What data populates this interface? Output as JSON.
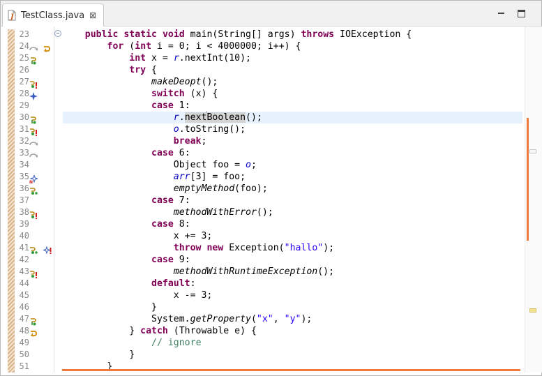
{
  "tab": {
    "title": "TestClass.java",
    "close_glyph": "⊠",
    "icon": "java-file-icon"
  },
  "window_controls": {
    "minimize": "minimize-icon",
    "maximize": "maximize-icon"
  },
  "colors": {
    "keyword": "#7f0055",
    "string": "#2a00ff",
    "field": "#0000c0",
    "comment": "#3f7f5f",
    "current_line": "#e8f2fe",
    "occurrence_mark": "#f07a3a"
  },
  "lines": [
    {
      "n": "23",
      "tokens": [
        [
          "p",
          "    "
        ],
        [
          "kw",
          "public"
        ],
        [
          "p",
          " "
        ],
        [
          "kw",
          "static"
        ],
        [
          "p",
          " "
        ],
        [
          "kw",
          "void"
        ],
        [
          "p",
          " main(String[] args) "
        ],
        [
          "kw",
          "throws"
        ],
        [
          "p",
          " IOException {"
        ]
      ]
    },
    {
      "n": "24",
      "tokens": [
        [
          "p",
          "        "
        ],
        [
          "kw",
          "for"
        ],
        [
          "p",
          " ("
        ],
        [
          "kw",
          "int"
        ],
        [
          "p",
          " i = 0; i < 4000000; i++) {"
        ]
      ]
    },
    {
      "n": "25",
      "tokens": [
        [
          "p",
          "            "
        ],
        [
          "kw",
          "int"
        ],
        [
          "p",
          " x = "
        ],
        [
          "fld",
          "r"
        ],
        [
          "p",
          ".nextInt(10);"
        ]
      ]
    },
    {
      "n": "26",
      "tokens": [
        [
          "p",
          "            "
        ],
        [
          "kw",
          "try"
        ],
        [
          "p",
          " {"
        ]
      ]
    },
    {
      "n": "27",
      "tokens": [
        [
          "p",
          "                "
        ],
        [
          "it",
          "makeDeopt"
        ],
        [
          "p",
          "();"
        ]
      ]
    },
    {
      "n": "28",
      "tokens": [
        [
          "p",
          "                "
        ],
        [
          "kw",
          "switch"
        ],
        [
          "p",
          " (x) {"
        ]
      ]
    },
    {
      "n": "29",
      "tokens": [
        [
          "p",
          "                "
        ],
        [
          "kw",
          "case"
        ],
        [
          "p",
          " 1:"
        ]
      ]
    },
    {
      "n": "30",
      "tokens": [
        [
          "p",
          "                    "
        ],
        [
          "fld",
          "r"
        ],
        [
          "p",
          "."
        ],
        [
          "occ",
          "next"
        ],
        [
          "caret",
          ""
        ],
        [
          "occ",
          "Boolean"
        ],
        [
          "p",
          "();"
        ]
      ],
      "current": true
    },
    {
      "n": "31",
      "tokens": [
        [
          "p",
          "                    "
        ],
        [
          "fld",
          "o"
        ],
        [
          "p",
          ".toString();"
        ]
      ]
    },
    {
      "n": "32",
      "tokens": [
        [
          "p",
          "                    "
        ],
        [
          "kw",
          "break"
        ],
        [
          "p",
          ";"
        ]
      ]
    },
    {
      "n": "33",
      "tokens": [
        [
          "p",
          "                "
        ],
        [
          "kw",
          "case"
        ],
        [
          "p",
          " 6:"
        ]
      ]
    },
    {
      "n": "34",
      "tokens": [
        [
          "p",
          "                    Object foo = "
        ],
        [
          "fld",
          "o"
        ],
        [
          "p",
          ";"
        ]
      ]
    },
    {
      "n": "35",
      "tokens": [
        [
          "p",
          "                    "
        ],
        [
          "fld",
          "arr"
        ],
        [
          "p",
          "[3] = foo;"
        ]
      ]
    },
    {
      "n": "36",
      "tokens": [
        [
          "p",
          "                    "
        ],
        [
          "it",
          "emptyMethod"
        ],
        [
          "p",
          "(foo);"
        ]
      ]
    },
    {
      "n": "37",
      "tokens": [
        [
          "p",
          "                "
        ],
        [
          "kw",
          "case"
        ],
        [
          "p",
          " 7:"
        ]
      ]
    },
    {
      "n": "38",
      "tokens": [
        [
          "p",
          "                    "
        ],
        [
          "it",
          "methodWithError"
        ],
        [
          "p",
          "();"
        ]
      ]
    },
    {
      "n": "39",
      "tokens": [
        [
          "p",
          "                "
        ],
        [
          "kw",
          "case"
        ],
        [
          "p",
          " 8:"
        ]
      ]
    },
    {
      "n": "40",
      "tokens": [
        [
          "p",
          "                    x += 3;"
        ]
      ]
    },
    {
      "n": "41",
      "tokens": [
        [
          "p",
          "                    "
        ],
        [
          "kw",
          "throw"
        ],
        [
          "p",
          " "
        ],
        [
          "kw",
          "new"
        ],
        [
          "p",
          " Exception("
        ],
        [
          "str",
          "\"hallo\""
        ],
        [
          "p",
          ");"
        ]
      ]
    },
    {
      "n": "42",
      "tokens": [
        [
          "p",
          "                "
        ],
        [
          "kw",
          "case"
        ],
        [
          "p",
          " 9:"
        ]
      ]
    },
    {
      "n": "43",
      "tokens": [
        [
          "p",
          "                    "
        ],
        [
          "it",
          "methodWithRuntimeException"
        ],
        [
          "p",
          "();"
        ]
      ]
    },
    {
      "n": "44",
      "tokens": [
        [
          "p",
          "                "
        ],
        [
          "kw",
          "default"
        ],
        [
          "p",
          ":"
        ]
      ]
    },
    {
      "n": "45",
      "tokens": [
        [
          "p",
          "                    x -= 3;"
        ]
      ]
    },
    {
      "n": "46",
      "tokens": [
        [
          "p",
          "                }"
        ]
      ]
    },
    {
      "n": "47",
      "tokens": [
        [
          "p",
          "                System."
        ],
        [
          "it",
          "getProperty"
        ],
        [
          "p",
          "("
        ],
        [
          "str",
          "\"x\""
        ],
        [
          "p",
          ", "
        ],
        [
          "str",
          "\"y\""
        ],
        [
          "p",
          ");"
        ]
      ]
    },
    {
      "n": "48",
      "tokens": [
        [
          "p",
          "            } "
        ],
        [
          "kw",
          "catch"
        ],
        [
          "p",
          " (Throwable e) {"
        ]
      ]
    },
    {
      "n": "49",
      "tokens": [
        [
          "p",
          "                "
        ],
        [
          "cmt",
          "// ignore"
        ]
      ]
    },
    {
      "n": "50",
      "tokens": [
        [
          "p",
          "            }"
        ]
      ]
    },
    {
      "n": "51",
      "tokens": [
        [
          "p",
          "        }"
        ]
      ]
    }
  ],
  "gutter_icons": [
    {
      "line": "24",
      "icons": [
        "step-over-gray-icon",
        "return-arrow-icon"
      ]
    },
    {
      "line": "25",
      "icons": [
        "step-into-icon"
      ]
    },
    {
      "line": "27",
      "icons": [
        "step-error-icon"
      ]
    },
    {
      "line": "28",
      "icons": [
        "deopt-star-icon"
      ]
    },
    {
      "line": "30",
      "icons": [
        "step-into-icon"
      ]
    },
    {
      "line": "31",
      "icons": [
        "step-error-icon"
      ]
    },
    {
      "line": "32",
      "icons": [
        "step-over-gray-icon"
      ]
    },
    {
      "line": "33",
      "icons": [
        "step-over-gray-icon"
      ]
    },
    {
      "line": "35",
      "icons": [
        "deopt-star-n-icon"
      ]
    },
    {
      "line": "36",
      "icons": [
        "step-into-multi-icon"
      ]
    },
    {
      "line": "38",
      "icons": [
        "step-error-icon"
      ]
    },
    {
      "line": "41",
      "icons": [
        "step-into-multi-icon",
        "deopt-star-error-icon"
      ]
    },
    {
      "line": "43",
      "icons": [
        "step-error-icon"
      ]
    },
    {
      "line": "47",
      "icons": [
        "step-into-icon"
      ]
    },
    {
      "line": "48",
      "icons": [
        "return-arrow-icon"
      ]
    }
  ]
}
